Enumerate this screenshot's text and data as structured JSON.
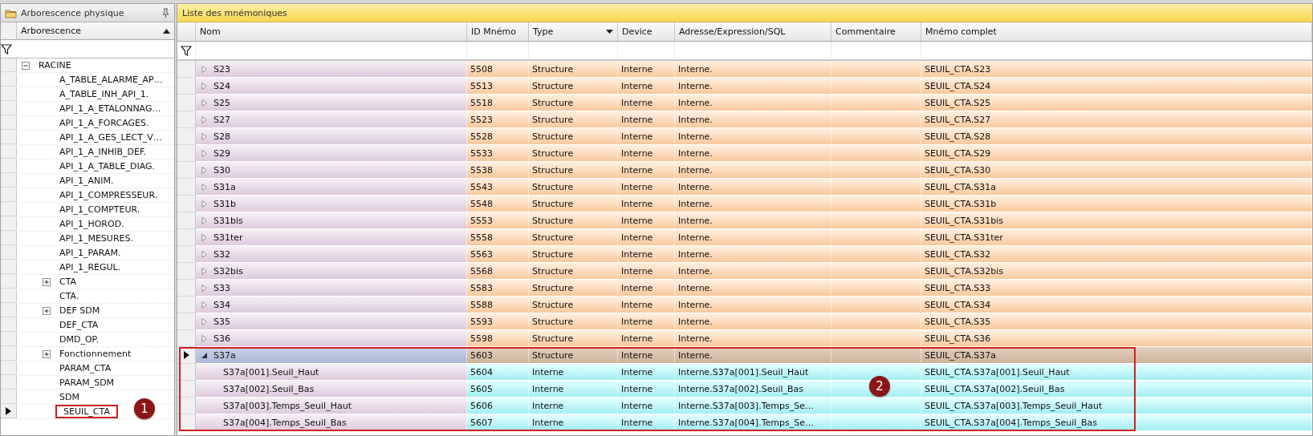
{
  "tree_panel": {
    "title": "Arborescence physique",
    "column": "Arborescence",
    "tree": [
      {
        "label": "RACINE",
        "expanded": true,
        "selected": false,
        "children": [
          {
            "label": "A_TABLE_ALARME_AP…",
            "selected": false
          },
          {
            "label": "A_TABLE_INH_API_1.",
            "selected": false
          },
          {
            "label": "API_1_A_ETALONNAG…",
            "selected": false
          },
          {
            "label": "API_1_A_FORCAGES.",
            "selected": false
          },
          {
            "label": "API_1_A_GES_LECT_V…",
            "selected": false
          },
          {
            "label": "API_1_A_INHIB_DEF.",
            "selected": false
          },
          {
            "label": "API_1_A_TABLE_DIAG.",
            "selected": false
          },
          {
            "label": "API_1_ANIM.",
            "selected": false
          },
          {
            "label": "API_1_COMPRESSEUR.",
            "selected": false
          },
          {
            "label": "API_1_COMPTEUR.",
            "selected": false
          },
          {
            "label": "API_1_HOROD.",
            "selected": false
          },
          {
            "label": "API_1_MESURES.",
            "selected": false
          },
          {
            "label": "API_1_PARAM.",
            "selected": false
          },
          {
            "label": "API_1_REGUL.",
            "selected": false
          },
          {
            "label": "CTA",
            "expanded": false,
            "selected": false
          },
          {
            "label": "CTA.",
            "selected": false
          },
          {
            "label": "DEF SDM",
            "expanded": false,
            "selected": false
          },
          {
            "label": "DEF_CTA",
            "selected": false
          },
          {
            "label": "DMD_OP.",
            "selected": false
          },
          {
            "label": "Fonctionnement",
            "expanded": false,
            "selected": false
          },
          {
            "label": "PARAM_CTA",
            "selected": false
          },
          {
            "label": "PARAM_SDM",
            "selected": false
          },
          {
            "label": "SDM",
            "selected": false
          },
          {
            "label": "SEUIL_CTA",
            "selected": true,
            "callout": "1"
          }
        ]
      }
    ]
  },
  "grid_panel": {
    "title": "Liste des mnémoniques",
    "columns": [
      {
        "label": "Nom",
        "dropdown": false
      },
      {
        "label": "ID Mnémo",
        "dropdown": false
      },
      {
        "label": "Type",
        "dropdown": true
      },
      {
        "label": "Device",
        "dropdown": false
      },
      {
        "label": "Adresse/Expression/SQL",
        "dropdown": false
      },
      {
        "label": "Commentaire",
        "dropdown": false
      },
      {
        "label": "Mnémo complet",
        "dropdown": false
      }
    ],
    "rows": [
      {
        "kind": "structure",
        "nom": "S23",
        "id": "5508",
        "type": "Structure",
        "device": "Interne",
        "adresse": "Interne.",
        "mnemo": "SEUIL_CTA.S23",
        "expanded": false,
        "selected": false
      },
      {
        "kind": "structure",
        "nom": "S24",
        "id": "5513",
        "type": "Structure",
        "device": "Interne",
        "adresse": "Interne.",
        "mnemo": "SEUIL_CTA.S24",
        "expanded": false,
        "selected": false
      },
      {
        "kind": "structure",
        "nom": "S25",
        "id": "5518",
        "type": "Structure",
        "device": "Interne",
        "adresse": "Interne.",
        "mnemo": "SEUIL_CTA.S25",
        "expanded": false,
        "selected": false
      },
      {
        "kind": "structure",
        "nom": "S27",
        "id": "5523",
        "type": "Structure",
        "device": "Interne",
        "adresse": "Interne.",
        "mnemo": "SEUIL_CTA.S27",
        "expanded": false,
        "selected": false
      },
      {
        "kind": "structure",
        "nom": "S28",
        "id": "5528",
        "type": "Structure",
        "device": "Interne",
        "adresse": "Interne.",
        "mnemo": "SEUIL_CTA.S28",
        "expanded": false,
        "selected": false
      },
      {
        "kind": "structure",
        "nom": "S29",
        "id": "5533",
        "type": "Structure",
        "device": "Interne",
        "adresse": "Interne.",
        "mnemo": "SEUIL_CTA.S29",
        "expanded": false,
        "selected": false
      },
      {
        "kind": "structure",
        "nom": "S30",
        "id": "5538",
        "type": "Structure",
        "device": "Interne",
        "adresse": "Interne.",
        "mnemo": "SEUIL_CTA.S30",
        "expanded": false,
        "selected": false
      },
      {
        "kind": "structure",
        "nom": "S31a",
        "id": "5543",
        "type": "Structure",
        "device": "Interne",
        "adresse": "Interne.",
        "mnemo": "SEUIL_CTA.S31a",
        "expanded": false,
        "selected": false
      },
      {
        "kind": "structure",
        "nom": "S31b",
        "id": "5548",
        "type": "Structure",
        "device": "Interne",
        "adresse": "Interne.",
        "mnemo": "SEUIL_CTA.S31b",
        "expanded": false,
        "selected": false
      },
      {
        "kind": "structure",
        "nom": "S31bis",
        "id": "5553",
        "type": "Structure",
        "device": "Interne",
        "adresse": "Interne.",
        "mnemo": "SEUIL_CTA.S31bis",
        "expanded": false,
        "selected": false
      },
      {
        "kind": "structure",
        "nom": "S31ter",
        "id": "5558",
        "type": "Structure",
        "device": "Interne",
        "adresse": "Interne.",
        "mnemo": "SEUIL_CTA.S31ter",
        "expanded": false,
        "selected": false
      },
      {
        "kind": "structure",
        "nom": "S32",
        "id": "5563",
        "type": "Structure",
        "device": "Interne",
        "adresse": "Interne.",
        "mnemo": "SEUIL_CTA.S32",
        "expanded": false,
        "selected": false
      },
      {
        "kind": "structure",
        "nom": "S32bis",
        "id": "5568",
        "type": "Structure",
        "device": "Interne",
        "adresse": "Interne.",
        "mnemo": "SEUIL_CTA.S32bis",
        "expanded": false,
        "selected": false
      },
      {
        "kind": "structure",
        "nom": "S33",
        "id": "5583",
        "type": "Structure",
        "device": "Interne",
        "adresse": "Interne.",
        "mnemo": "SEUIL_CTA.S33",
        "expanded": false,
        "selected": false
      },
      {
        "kind": "structure",
        "nom": "S34",
        "id": "5588",
        "type": "Structure",
        "device": "Interne",
        "adresse": "Interne.",
        "mnemo": "SEUIL_CTA.S34",
        "expanded": false,
        "selected": false
      },
      {
        "kind": "structure",
        "nom": "S35",
        "id": "5593",
        "type": "Structure",
        "device": "Interne",
        "adresse": "Interne.",
        "mnemo": "SEUIL_CTA.S35",
        "expanded": false,
        "selected": false
      },
      {
        "kind": "structure",
        "nom": "S36",
        "id": "5598",
        "type": "Structure",
        "device": "Interne",
        "adresse": "Interne.",
        "mnemo": "SEUIL_CTA.S36",
        "expanded": false,
        "selected": false
      },
      {
        "kind": "structure",
        "nom": "S37a",
        "id": "5603",
        "type": "Structure",
        "device": "Interne",
        "adresse": "Interne.",
        "mnemo": "SEUIL_CTA.S37a",
        "expanded": true,
        "selected": true,
        "callout": "2",
        "children": [
          {
            "kind": "member",
            "nom": "S37a[001].Seuil_Haut",
            "id": "5604",
            "type": "Interne",
            "device": "Interne",
            "adresse": "Interne.S37a[001].Seuil_Haut",
            "mnemo": "SEUIL_CTA.S37a[001].Seuil_Haut",
            "selected": false
          },
          {
            "kind": "member",
            "nom": "S37a[002].Seuil_Bas",
            "id": "5605",
            "type": "Interne",
            "device": "Interne",
            "adresse": "Interne.S37a[002].Seuil_Bas",
            "mnemo": "SEUIL_CTA.S37a[002].Seuil_Bas",
            "selected": false
          },
          {
            "kind": "member",
            "nom": "S37a[003].Temps_Seuil_Haut",
            "id": "5606",
            "type": "Interne",
            "device": "Interne",
            "adresse": "Interne.S37a[003].Temps_Se…",
            "mnemo": "SEUIL_CTA.S37a[003].Temps_Seuil_Haut",
            "selected": false
          },
          {
            "kind": "member",
            "nom": "S37a[004].Temps_Seuil_Bas",
            "id": "5607",
            "type": "Interne",
            "device": "Interne",
            "adresse": "Interne.S37a[004].Temps_Se…",
            "mnemo": "SEUIL_CTA.S37a[004].Temps_Seuil_Bas",
            "selected": false
          }
        ]
      }
    ]
  }
}
